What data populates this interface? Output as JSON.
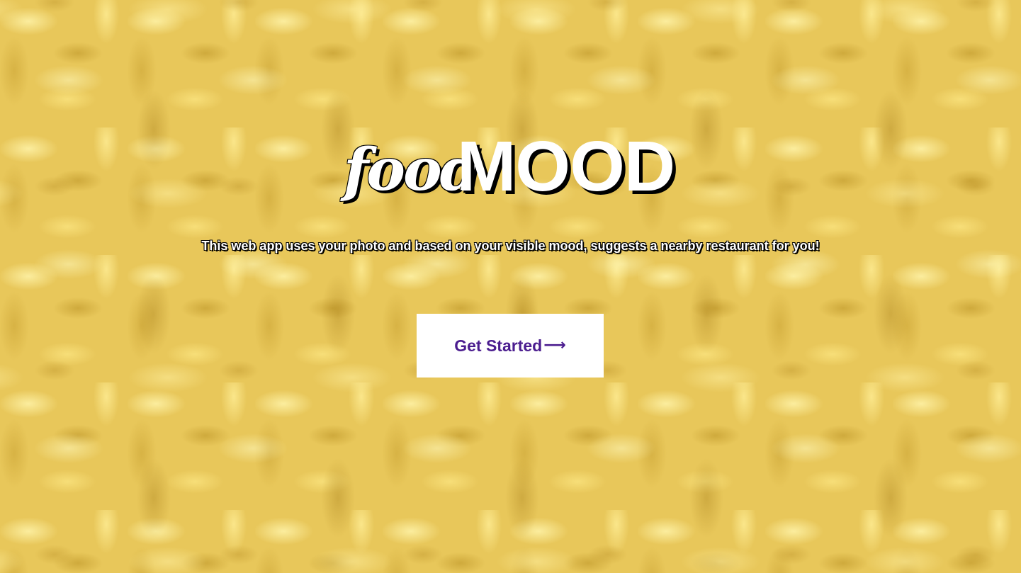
{
  "hero": {
    "background_icon": "fusilli-pasta-photo",
    "background_color": "#e8c75a"
  },
  "logo": {
    "script_part": "food",
    "bold_part": "MOOD"
  },
  "tagline": "This web app uses your photo and based on your visible mood, suggests a nearby restaurant for you!",
  "cta": {
    "label": "Get Started",
    "arrow": "⟶",
    "arrow_icon": "arrow-right-icon",
    "text_color": "#4b1d8f",
    "background_color": "#ffffff"
  }
}
